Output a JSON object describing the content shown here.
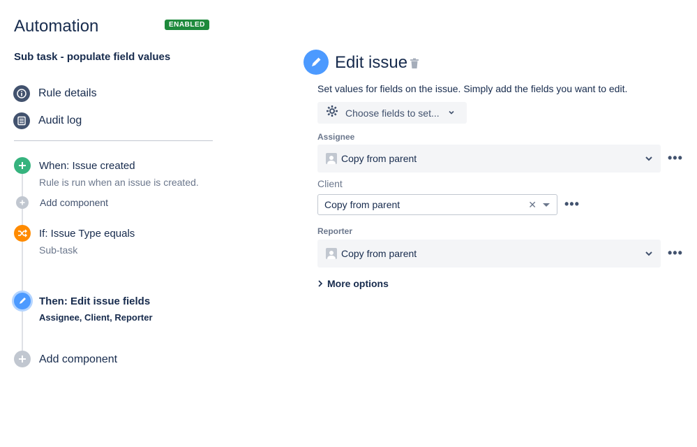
{
  "sidebar": {
    "app_title": "Automation",
    "status_badge": "ENABLED",
    "rule_name": "Sub task - populate field values",
    "nav": [
      {
        "label": "Rule details",
        "icon": "info-icon"
      },
      {
        "label": "Audit log",
        "icon": "list-icon"
      }
    ],
    "timeline": {
      "trigger": {
        "title": "When: Issue created",
        "subtitle": "Rule is run when an issue is created.",
        "icon": "plus-icon"
      },
      "add_component_1": "Add component",
      "condition": {
        "title": "If: Issue Type equals",
        "subtitle": "Sub-task",
        "icon": "shuffle-icon"
      },
      "action": {
        "title": "Then: Edit issue fields",
        "subtitle": "Assignee, Client, Reporter",
        "icon": "pencil-icon"
      },
      "add_component_2": "Add component"
    }
  },
  "main": {
    "title": "Edit issue",
    "description": "Set values for fields on the issue. Simply add the fields you want to edit.",
    "choose_fields_label": "Choose fields to set...",
    "fields": {
      "assignee": {
        "label": "Assignee",
        "value": "Copy from parent"
      },
      "client": {
        "label": "Client",
        "value": "Copy from parent"
      },
      "reporter": {
        "label": "Reporter",
        "value": "Copy from parent"
      }
    },
    "more_options_label": "More options",
    "more_menu_glyph": "•••"
  },
  "colors": {
    "badge_green": "#1e8a3c",
    "trigger_green": "#36b37e",
    "condition_orange": "#ff8b00",
    "action_blue": "#4c9aff",
    "nav_icon": "#42526e"
  }
}
